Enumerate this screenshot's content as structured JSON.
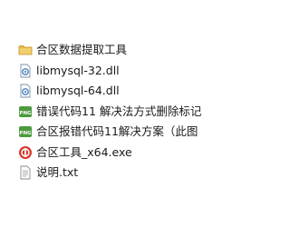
{
  "files": [
    {
      "name": "合区数据提取工具",
      "icon": "folder-icon"
    },
    {
      "name": "libmysql-32.dll",
      "icon": "dll-icon"
    },
    {
      "name": "libmysql-64.dll",
      "icon": "dll-icon"
    },
    {
      "name": "错误代码11 解决法方式删除标记",
      "icon": "png-image-icon"
    },
    {
      "name": "合区报错代码11解决方案（此图",
      "icon": "png-image-icon"
    },
    {
      "name": "合区工具_x64.exe",
      "icon": "exe-app-icon"
    },
    {
      "name": "说明.txt",
      "icon": "txt-file-icon"
    }
  ],
  "colors": {
    "folder": "#e8b84a",
    "dll_border": "#4a7fc0",
    "png_green": "#4c9a3c",
    "exe_red": "#d8362c"
  }
}
